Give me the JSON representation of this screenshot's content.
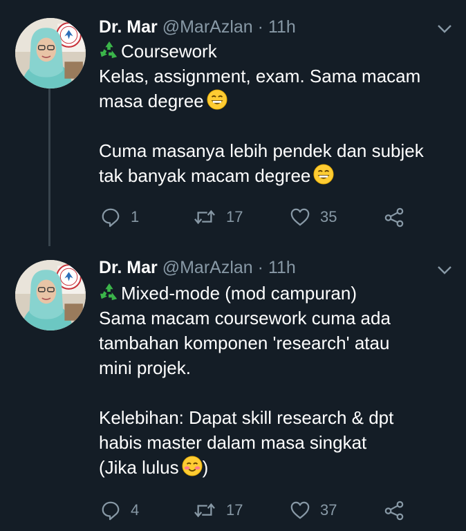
{
  "colors": {
    "background": "#141d26",
    "secondary": "#8899a6",
    "thread_line": "#38444d"
  },
  "tweets": [
    {
      "author": {
        "name": "Dr. Mar",
        "handle": "@MarAzlan"
      },
      "separator": "·",
      "time": "11h",
      "lines": [
        "Coursework",
        "Kelas, assignment, exam. Sama macam",
        "masa degree",
        "",
        "Cuma masanya lebih pendek dan subjek",
        "tak banyak macam degree"
      ],
      "stats": {
        "replies": "1",
        "retweets": "17",
        "likes": "35"
      }
    },
    {
      "author": {
        "name": "Dr. Mar",
        "handle": "@MarAzlan"
      },
      "separator": "·",
      "time": "11h",
      "lines": [
        "Mixed-mode (mod campuran)",
        "Sama macam coursework cuma ada",
        "tambahan komponen 'research' atau",
        "mini projek.",
        "",
        "Kelebihan: Dapat skill research & dpt",
        "habis master dalam masa singkat",
        "(Jika lulus",
        ")"
      ],
      "stats": {
        "replies": "4",
        "retweets": "17",
        "likes": "37"
      }
    }
  ],
  "icons": [
    "recycle-icon",
    "grin-emoji-icon",
    "blush-emoji-icon",
    "reply-icon",
    "retweet-icon",
    "heart-icon",
    "share-icon",
    "chevron-down-icon"
  ]
}
